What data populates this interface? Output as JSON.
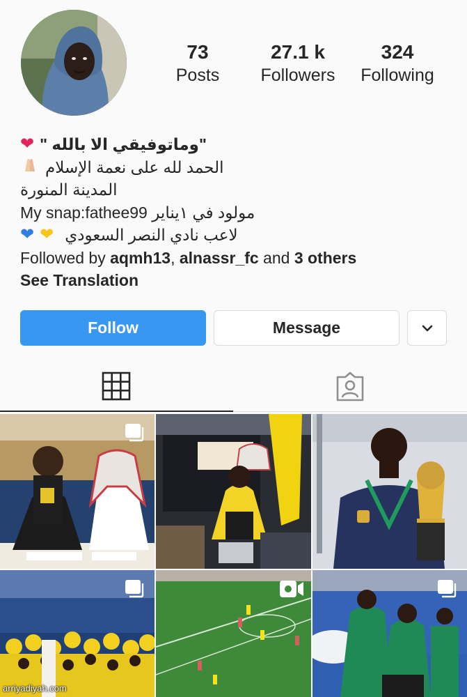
{
  "profile": {
    "avatar_icon": "profile-photo-hooded-man",
    "stats": {
      "posts": {
        "count": "73",
        "label": "Posts"
      },
      "followers": {
        "count": "27.1 k",
        "label": "Followers"
      },
      "following": {
        "count": "324",
        "label": "Following"
      }
    },
    "bio": {
      "line1": "\"وماتوفيقي الا بالله \"",
      "line1_icon": "red-heart-icon",
      "line2": "الحمد لله على نعمة الإسلام",
      "line2_icon": "praying-hands-icon",
      "line3": "المدينة المنورة",
      "line4": "مولود في ١يناير My snap:fathee99",
      "line5": "لاعب نادي النصر السعودي",
      "line5_icons": [
        "yellow-heart-icon",
        "blue-heart-icon"
      ],
      "followed_by_prefix": "Followed by",
      "followed_by_user1": "aqmh13",
      "followed_by_sep": ",",
      "followed_by_user2": "alnassr_fc",
      "followed_by_and": "and",
      "followed_by_others": "3 others",
      "see_translation": "See Translation"
    }
  },
  "actions": {
    "follow_label": "Follow",
    "message_label": "Message",
    "more_icon": "chevron-down-icon"
  },
  "tabs": [
    {
      "name": "grid",
      "icon": "grid-icon",
      "active": true
    },
    {
      "name": "tagged",
      "icon": "tagged-person-icon",
      "active": false
    }
  ],
  "posts": [
    {
      "scene": "contract signing",
      "badge": "multiple-photos-icon"
    },
    {
      "scene": "team bus celebration",
      "badge": ""
    },
    {
      "scene": "player with trophy",
      "badge": ""
    },
    {
      "scene": "team celebration",
      "badge": "multiple-photos-icon"
    },
    {
      "scene": "match footage",
      "badge": "video-icon"
    },
    {
      "scene": "training session",
      "badge": "multiple-photos-icon"
    }
  ],
  "colors": {
    "accent": "#3897f0",
    "text": "#262626",
    "border": "#dbdbdb",
    "background": "#fafafa"
  },
  "watermark": "arriyadiyah.com"
}
